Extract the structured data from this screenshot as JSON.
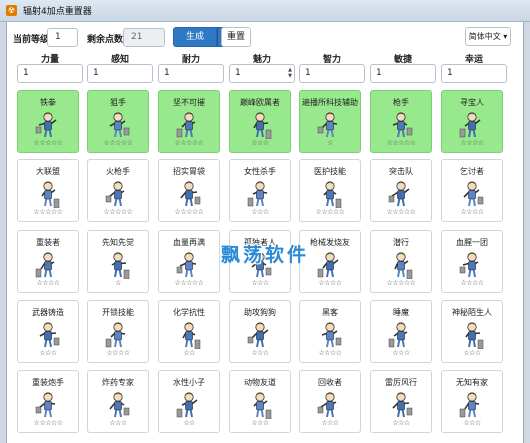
{
  "window": {
    "title": "辐射4加点重置器",
    "icon_name": "app-icon"
  },
  "toolbar": {
    "level_label": "当前等级",
    "level_value": "1",
    "points_label": "剩余点数",
    "points_value": "21",
    "generate_label": "生成",
    "reset_label": "重置",
    "lang_label": "简体中文 ▾"
  },
  "stats": [
    {
      "name": "力量",
      "value": "1"
    },
    {
      "name": "感知",
      "value": "1"
    },
    {
      "name": "耐力",
      "value": "1"
    },
    {
      "name": "魅力",
      "value": "1"
    },
    {
      "name": "智力",
      "value": "1"
    },
    {
      "name": "敏捷",
      "value": "1"
    },
    {
      "name": "幸运",
      "value": "1"
    }
  ],
  "perk_rows": [
    [
      {
        "name": "铁拳",
        "stars": "☆☆☆☆☆",
        "selected": true,
        "icon": "fist-icon"
      },
      {
        "name": "狙手",
        "stars": "☆☆☆☆☆",
        "selected": true,
        "icon": "rifleman-icon"
      },
      {
        "name": "坚不可摧",
        "stars": "☆☆☆☆☆",
        "selected": true,
        "icon": "toughness-icon"
      },
      {
        "name": "巅峰欧属者",
        "stars": "☆☆☆",
        "selected": true,
        "icon": "shopkeeper-icon"
      },
      {
        "name": "遍播所科技辅助",
        "stars": "☆",
        "selected": true,
        "icon": "science-icon"
      },
      {
        "name": "枪手",
        "stars": "☆☆☆☆☆",
        "selected": true,
        "icon": "gunslinger-icon"
      },
      {
        "name": "寻宝人",
        "stars": "☆☆☆☆",
        "selected": true,
        "icon": "scrounger-icon"
      }
    ],
    [
      {
        "name": "大联盟",
        "stars": "☆☆☆☆☆",
        "selected": false,
        "icon": "bat-icon"
      },
      {
        "name": "火枪手",
        "stars": "☆☆☆☆☆",
        "selected": false,
        "icon": "musket-icon"
      },
      {
        "name": "招实胃袋",
        "stars": "☆☆☆☆☆",
        "selected": false,
        "icon": "stomach-icon"
      },
      {
        "name": "女性杀手",
        "stars": "☆☆☆",
        "selected": false,
        "icon": "lady-killer-icon"
      },
      {
        "name": "医护技能",
        "stars": "☆☆☆☆☆",
        "selected": false,
        "icon": "medic-icon"
      },
      {
        "name": "突击队",
        "stars": "☆☆☆☆☆",
        "selected": false,
        "icon": "commando-icon"
      },
      {
        "name": "乞讨者",
        "stars": "☆☆☆☆",
        "selected": false,
        "icon": "fortune-finder-icon"
      }
    ],
    [
      {
        "name": "重装者",
        "stars": "☆☆☆☆",
        "selected": false,
        "icon": "armorer-icon"
      },
      {
        "name": "先知先觉",
        "stars": "☆",
        "selected": false,
        "icon": "awareness-icon"
      },
      {
        "name": "血量再满",
        "stars": "☆☆☆☆☆",
        "selected": false,
        "icon": "lifegiver-icon"
      },
      {
        "name": "孤独者人",
        "stars": "☆☆☆",
        "selected": false,
        "icon": "lone-wanderer-icon"
      },
      {
        "name": "枪械发烧友",
        "stars": "☆☆☆☆",
        "selected": false,
        "icon": "gun-nut-icon"
      },
      {
        "name": "潜行",
        "stars": "☆☆☆☆☆",
        "selected": false,
        "icon": "sneak-icon"
      },
      {
        "name": "血腥一团",
        "stars": "☆☆☆☆",
        "selected": false,
        "icon": "bloody-mess-icon"
      }
    ],
    [
      {
        "name": "武器铸造",
        "stars": "☆☆☆",
        "selected": false,
        "icon": "blacksmith-icon"
      },
      {
        "name": "开锁技能",
        "stars": "☆☆☆☆",
        "selected": false,
        "icon": "locksmith-icon"
      },
      {
        "name": "化学抗性",
        "stars": "☆☆",
        "selected": false,
        "icon": "chem-resistant-icon"
      },
      {
        "name": "助攻狗狗",
        "stars": "☆☆☆",
        "selected": false,
        "icon": "attack-dog-icon"
      },
      {
        "name": "黑客",
        "stars": "☆☆☆☆",
        "selected": false,
        "icon": "hacker-icon"
      },
      {
        "name": "睡魔",
        "stars": "☆☆☆",
        "selected": false,
        "icon": "sandman-icon"
      },
      {
        "name": "神秘陌生人",
        "stars": "☆☆☆",
        "selected": false,
        "icon": "mysterious-stranger-icon"
      }
    ],
    [
      {
        "name": "重装炮手",
        "stars": "☆☆☆☆☆",
        "selected": false,
        "icon": "heavy-gunner-icon"
      },
      {
        "name": "炸药专家",
        "stars": "☆☆☆",
        "selected": false,
        "icon": "demolition-icon"
      },
      {
        "name": "水性小子",
        "stars": "☆☆",
        "selected": false,
        "icon": "aquaboy-icon"
      },
      {
        "name": "动物友道",
        "stars": "☆☆☆",
        "selected": false,
        "icon": "animal-friend-icon"
      },
      {
        "name": "回收者",
        "stars": "☆☆☆",
        "selected": false,
        "icon": "scrapper-icon"
      },
      {
        "name": "雷厉风行",
        "stars": "☆☆☆",
        "selected": false,
        "icon": "action-boy-icon"
      },
      {
        "name": "无知有家",
        "stars": "☆☆☆",
        "selected": false,
        "icon": "idiot-savant-icon"
      }
    ]
  ],
  "watermark": "飘荡软件",
  "colors": {
    "selected_bg": "#98e88e",
    "primary_button": "#2f78c4",
    "watermark": "#2b8ad6"
  }
}
